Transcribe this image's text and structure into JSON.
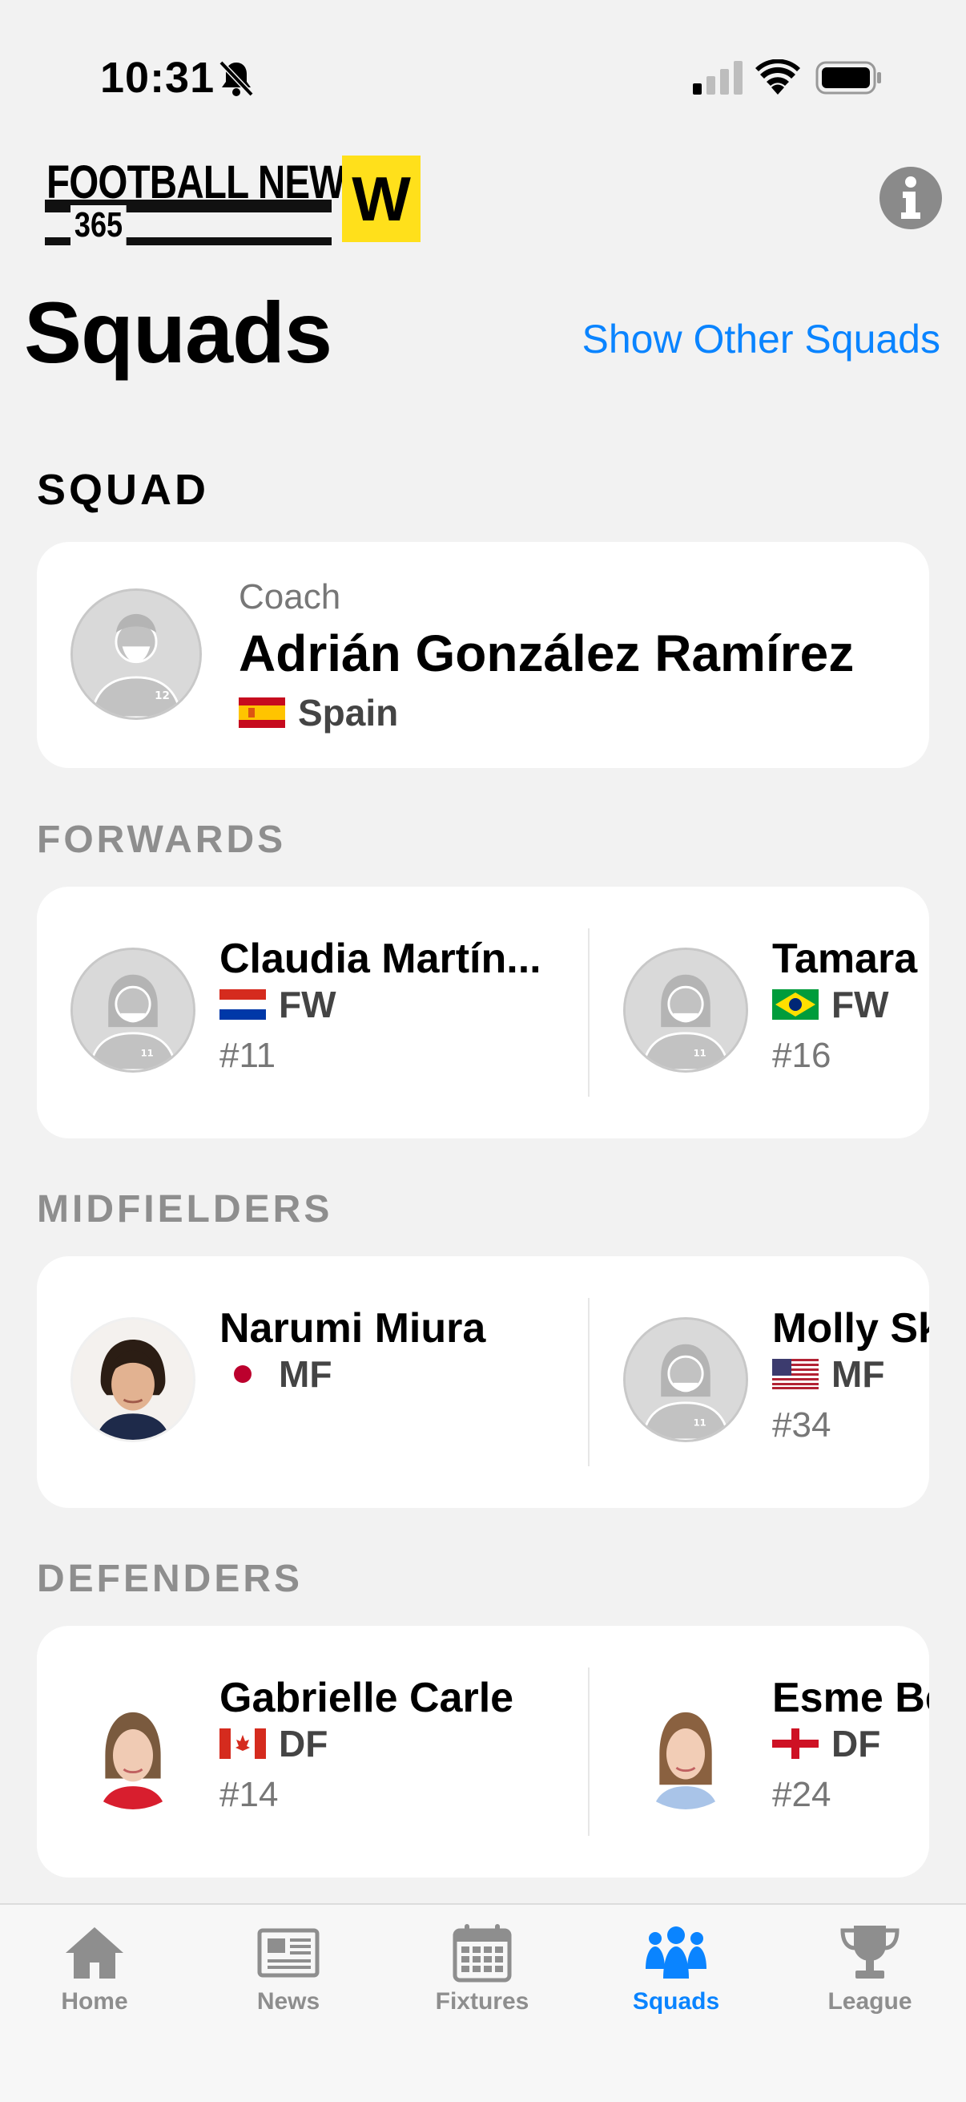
{
  "status": {
    "time": "10:31"
  },
  "header": {
    "logo_line1": "FOOTBALL NEWS",
    "logo_line2": "365",
    "logo_badge": "W",
    "page_title": "Squads",
    "show_other_label": "Show Other Squads"
  },
  "squad": {
    "section_label": "SQUAD",
    "coach": {
      "role": "Coach",
      "name": "Adrián González Ramírez",
      "country": "Spain",
      "flag_icon": "spain-flag-icon"
    }
  },
  "forwards": {
    "section_label": "FORWARDS",
    "players": [
      {
        "name": "Claudia Martín...",
        "position": "FW",
        "number": "#11",
        "flag_icon": "paraguay-flag-icon"
      },
      {
        "name": "Tamara",
        "position": "FW",
        "number": "#16",
        "flag_icon": "brazil-flag-icon"
      }
    ]
  },
  "midfielders": {
    "section_label": "MIDFIELDERS",
    "players": [
      {
        "name": "Narumi Miura",
        "position": "MF",
        "number": "",
        "flag_icon": "japan-flag-icon"
      },
      {
        "name": "Molly Sk",
        "position": "MF",
        "number": "#34",
        "flag_icon": "usa-flag-icon"
      }
    ]
  },
  "defenders": {
    "section_label": "DEFENDERS",
    "players": [
      {
        "name": "Gabrielle Carle",
        "position": "DF",
        "number": "#14",
        "flag_icon": "canada-flag-icon"
      },
      {
        "name": "Esme Be",
        "position": "DF",
        "number": "#24",
        "flag_icon": "england-flag-icon"
      }
    ]
  },
  "tabs": [
    {
      "label": "Home",
      "icon": "home-icon",
      "active": false
    },
    {
      "label": "News",
      "icon": "news-icon",
      "active": false
    },
    {
      "label": "Fixtures",
      "icon": "calendar-icon",
      "active": false
    },
    {
      "label": "Squads",
      "icon": "people-icon",
      "active": true
    },
    {
      "label": "League",
      "icon": "trophy-icon",
      "active": false
    }
  ],
  "colors": {
    "accent": "#0a84ff",
    "badge_yellow": "#ffe01b",
    "muted": "#8e8e8e"
  }
}
